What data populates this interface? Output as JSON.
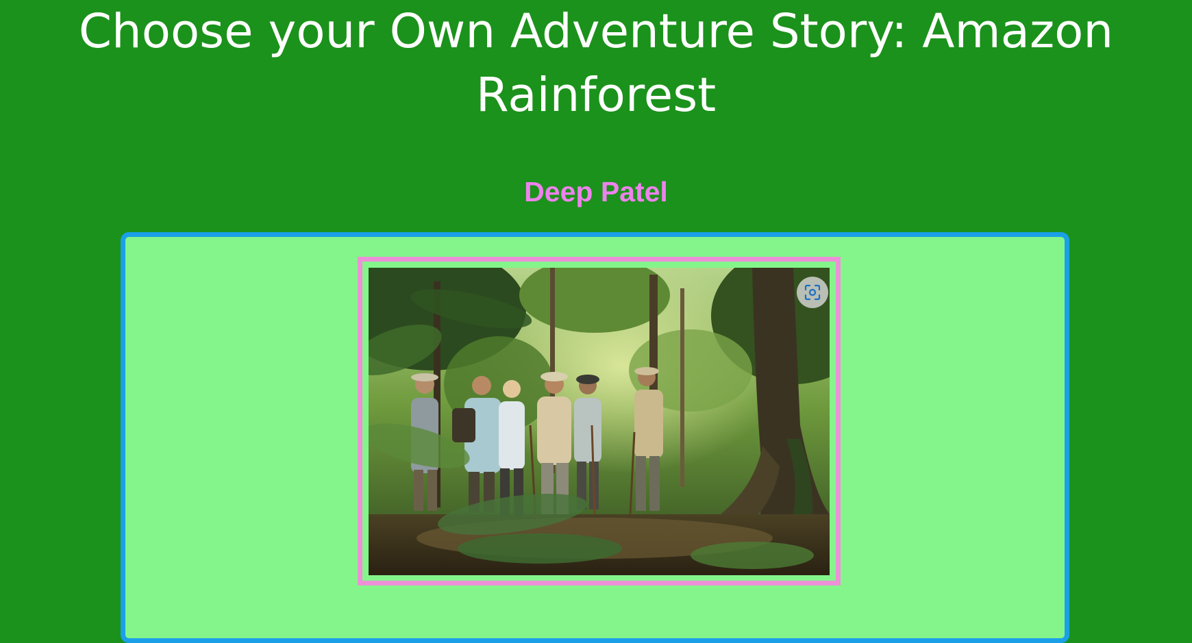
{
  "page": {
    "title_line_1": "Choose your Own Adventure Story: Amazon",
    "title_line_2": "Rainforest",
    "author": "Deep Patel"
  },
  "colors": {
    "page_background": "#1b921b",
    "title_text": "#ffffff",
    "author_text": "#ee82ee",
    "card_background": "#84f58b",
    "card_border": "#1ba0e8",
    "photo_frame_border": "#ee90d8",
    "lens_icon": "#1a6fc4"
  },
  "story_image": {
    "visual_search_icon": "lens-scan-icon"
  }
}
